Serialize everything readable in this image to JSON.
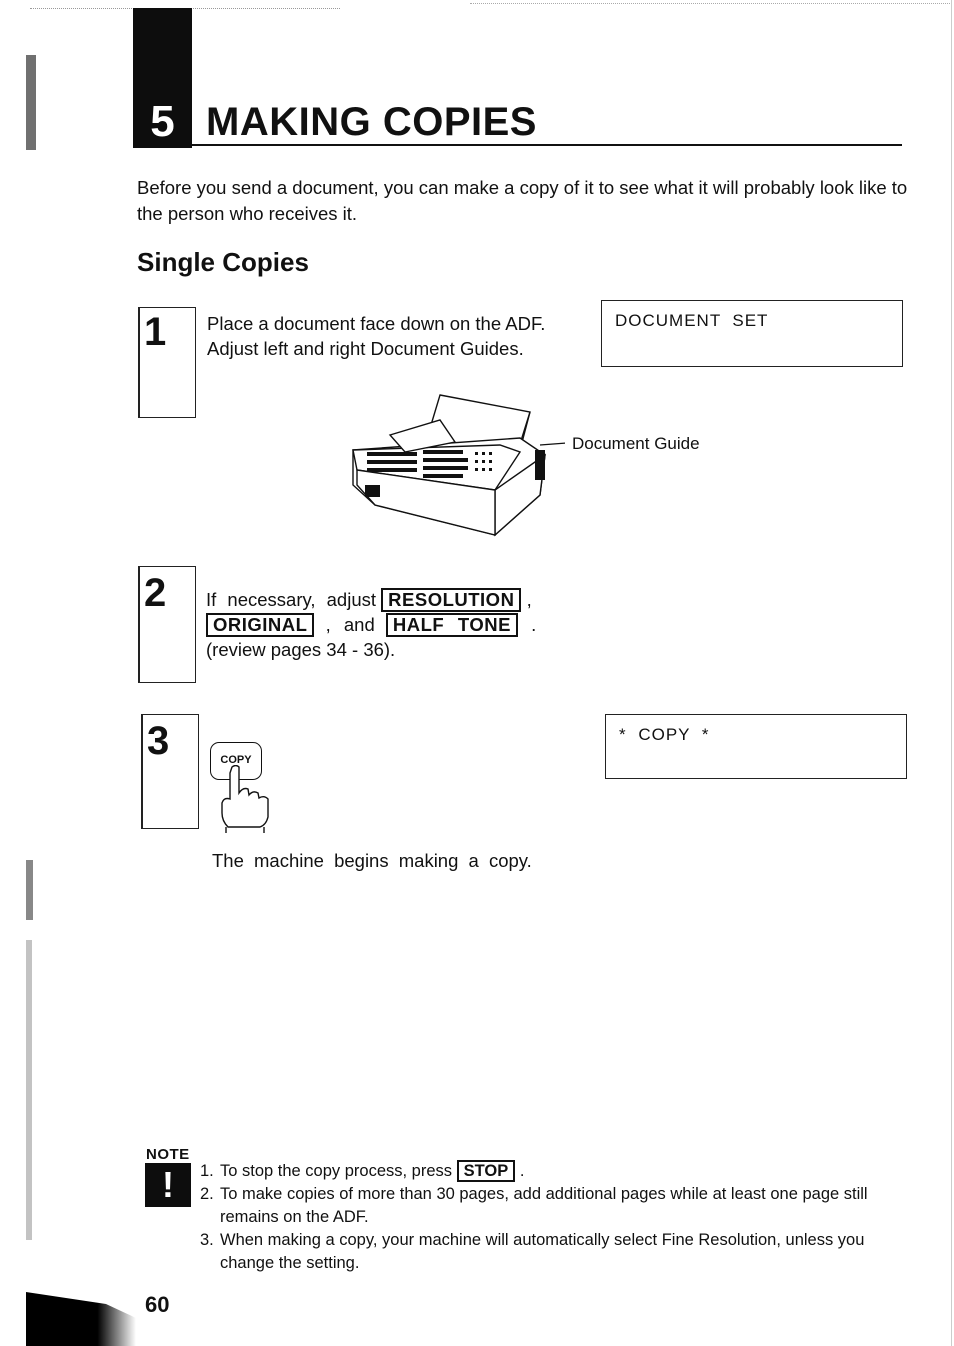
{
  "chapter": {
    "number": "5",
    "title": "MAKING COPIES"
  },
  "intro": "Before you send a document, you can make a copy of it to see what it will probably look like to the person who receives it.",
  "section_heading": "Single Copies",
  "steps": [
    {
      "number": "1",
      "lines": [
        "Place a document face down on the ADF.",
        "Adjust left and right Document Guides."
      ],
      "display": "DOCUMENT  SET",
      "illustration_callout": "Document Guide"
    },
    {
      "number": "2",
      "text_prefix": "If necessary, adjust",
      "keys": [
        "RESOLUTION",
        "ORIGINAL",
        "HALF TONE"
      ],
      "sep_comma": ",",
      "sep_and": ", and",
      "end_period": ".",
      "review": "(review pages 34 - 36)."
    },
    {
      "number": "3",
      "button_label": "COPY",
      "display": "* COPY *",
      "result": "The machine begins making a copy."
    }
  ],
  "note": {
    "label": "NOTE",
    "icon": "!",
    "items": [
      {
        "n": "1.",
        "text": "To stop the copy process, press",
        "key": "STOP",
        "end": "."
      },
      {
        "n": "2.",
        "text": "To make copies of more than 30 pages, add additional pages while at least one page still remains on the ADF."
      },
      {
        "n": "3.",
        "text": "When making a copy, your machine will automatically select Fine Resolution, unless you change the setting."
      }
    ]
  },
  "page_number": "60"
}
